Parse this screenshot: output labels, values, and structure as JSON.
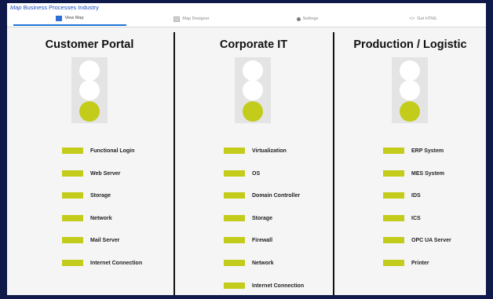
{
  "app": {
    "title_italic": "Map",
    "title_rest": "Business Processes Industry"
  },
  "tabs": [
    {
      "label": "View Map",
      "icon": "map-icon",
      "active": true
    },
    {
      "label": "Map Designer",
      "icon": "designer-icon",
      "active": false
    },
    {
      "label": "Settings",
      "icon": "gear-icon",
      "active": false
    },
    {
      "label": "Get HTML",
      "icon": "code-icon",
      "active": false
    }
  ],
  "status_color": "#c3cc1a",
  "columns": [
    {
      "title": "Customer Portal",
      "light_state": "green",
      "services": [
        "Functional Login",
        "Web Server",
        "Storage",
        "Network",
        "Mail Server",
        "Internet Connection"
      ]
    },
    {
      "title": "Corporate IT",
      "light_state": "green",
      "services": [
        "Virtualization",
        "OS",
        "Domain Controller",
        "Storage",
        "Firewall",
        "Network",
        "Internet Connection"
      ]
    },
    {
      "title": "Production / Logistic",
      "light_state": "green",
      "services": [
        "ERP System",
        "MES System",
        "IDS",
        "ICS",
        "OPC UA Server",
        "Printer"
      ]
    }
  ]
}
